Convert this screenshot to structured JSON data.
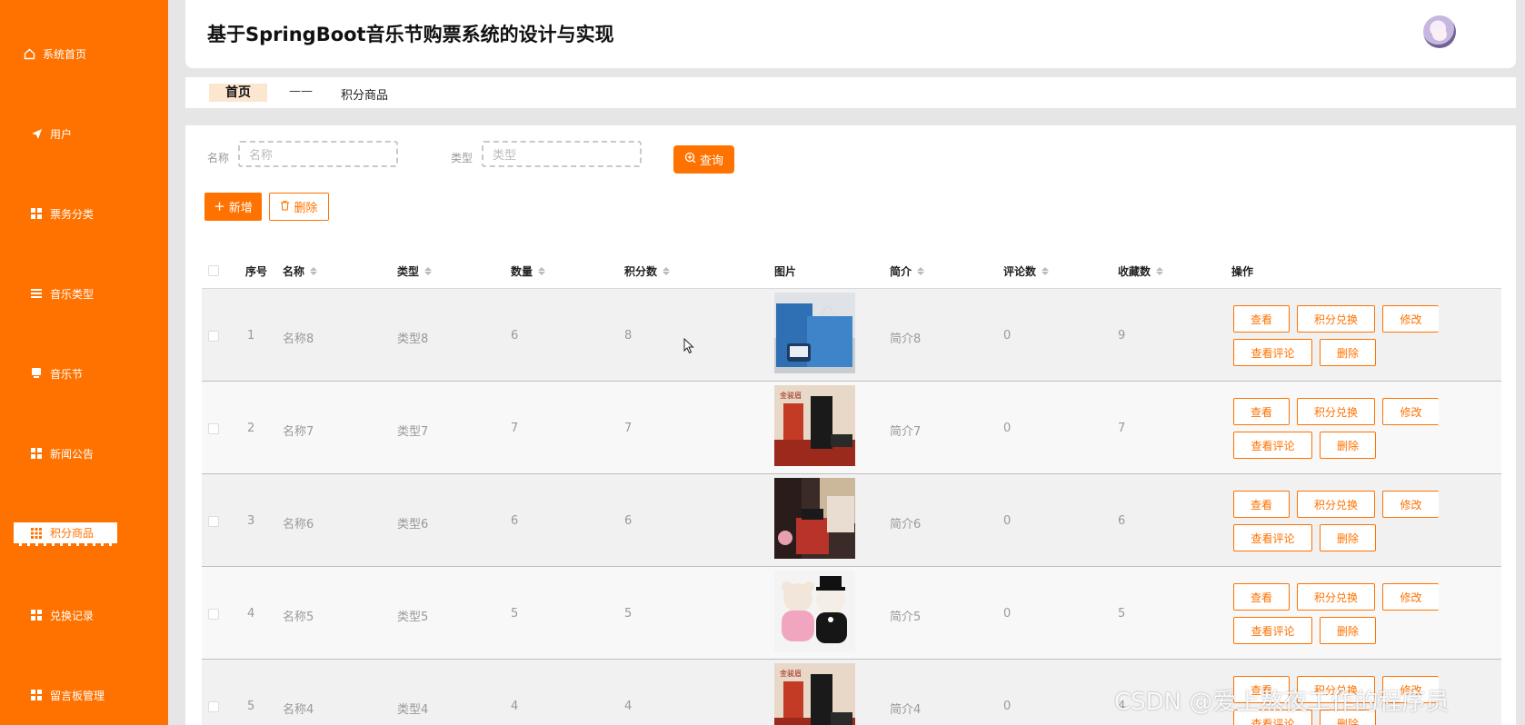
{
  "sidebar": {
    "items": [
      {
        "label": "系统首页",
        "icon": "home-icon"
      },
      {
        "label": "用户",
        "icon": "send-icon"
      },
      {
        "label": "票务分类",
        "icon": "grid-icon"
      },
      {
        "label": "音乐类型",
        "icon": "list-icon"
      },
      {
        "label": "音乐节",
        "icon": "monitor-icon"
      },
      {
        "label": "新闻公告",
        "icon": "grid-icon"
      },
      {
        "label": "积分商品",
        "icon": "apps-icon"
      },
      {
        "label": "兑换记录",
        "icon": "grid-icon"
      },
      {
        "label": "留言板管理",
        "icon": "grid-icon"
      }
    ]
  },
  "header": {
    "title": "基于SpringBoot音乐节购票系统的设计与实现"
  },
  "breadcrumb": {
    "home": "首页",
    "separator": "——",
    "current": "积分商品"
  },
  "search": {
    "name_label": "名称",
    "name_placeholder": "名称",
    "type_label": "类型",
    "type_placeholder": "类型",
    "query_label": "查询"
  },
  "toolbar": {
    "add_label": "新增",
    "delete_label": "删除"
  },
  "table": {
    "headers": {
      "index": "序号",
      "name": "名称",
      "type": "类型",
      "quantity": "数量",
      "points": "积分数",
      "image": "图片",
      "intro": "简介",
      "comments": "评论数",
      "favorites": "收藏数",
      "actions": "操作"
    },
    "rows": [
      {
        "index": "1",
        "name": "名称8",
        "type": "类型8",
        "quantity": "6",
        "points": "8",
        "intro": "简介8",
        "comments": "0",
        "favorites": "9",
        "image": "blue-gift-box"
      },
      {
        "index": "2",
        "name": "名称7",
        "type": "类型7",
        "quantity": "7",
        "points": "7",
        "intro": "简介7",
        "comments": "0",
        "favorites": "7",
        "image": "red-tea-gift"
      },
      {
        "index": "3",
        "name": "名称6",
        "type": "类型6",
        "quantity": "6",
        "points": "6",
        "intro": "简介6",
        "comments": "0",
        "favorites": "6",
        "image": "gift-bags"
      },
      {
        "index": "4",
        "name": "名称5",
        "type": "类型5",
        "quantity": "5",
        "points": "5",
        "intro": "简介5",
        "comments": "0",
        "favorites": "5",
        "image": "teddy-bears"
      },
      {
        "index": "5",
        "name": "名称4",
        "type": "类型4",
        "quantity": "4",
        "points": "4",
        "intro": "简介4",
        "comments": "0",
        "favorites": "4",
        "image": "red-tea-gift"
      }
    ],
    "actions": {
      "view": "查看",
      "redeem": "积分兑换",
      "edit": "修改",
      "view_comments": "查看评论",
      "delete": "删除"
    }
  },
  "watermark": "CSDN @爱上熬夜工作的程序员",
  "colors": {
    "accent": "#ff7200",
    "sidebar_bg": "#ff7200",
    "page_bg": "#e6e6e6"
  }
}
